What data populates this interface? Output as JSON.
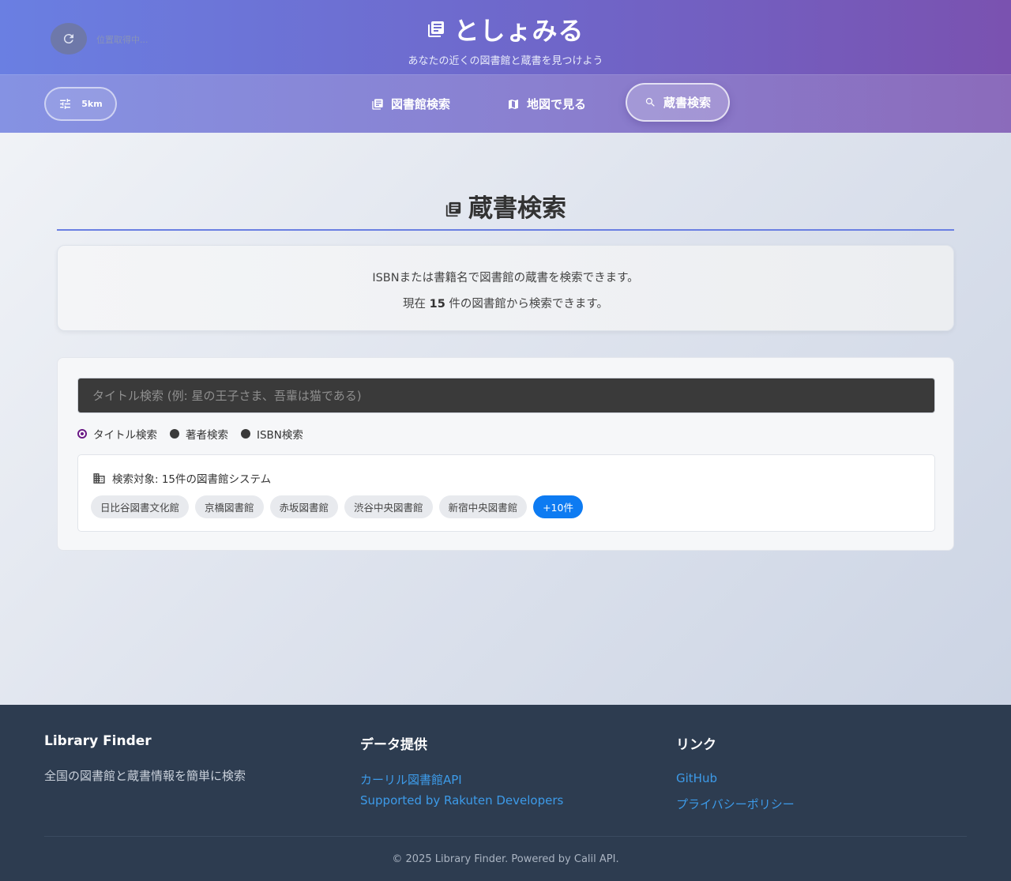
{
  "header": {
    "location_status": "位置取得中...",
    "app_title": "としょみる",
    "subtitle": "あなたの近くの図書館と蔵書を見つけよう"
  },
  "nav": {
    "range_label": "5km",
    "items": [
      {
        "label": "図書館検索",
        "icon": "library-icon"
      },
      {
        "label": "地図で見る",
        "icon": "map-icon"
      },
      {
        "label": "蔵書検索",
        "icon": "search-icon",
        "active": true
      }
    ]
  },
  "main": {
    "page_title": "蔵書検索",
    "info_line1": "ISBNまたは書籍名で図書館の蔵書を検索できます。",
    "info_line2_prefix": "現在",
    "info_count": "15",
    "info_line2_suffix": "件の図書館から検索できます。",
    "search": {
      "placeholder": "タイトル検索 (例: 星の王子さま、吾輩は猫である)",
      "value": "",
      "modes": [
        {
          "label": "タイトル検索",
          "selected": true
        },
        {
          "label": "著者検索",
          "selected": false
        },
        {
          "label": "ISBN検索",
          "selected": false
        }
      ]
    },
    "targets": {
      "heading": "検索対象: 15件の図書館システム",
      "libraries": [
        "日比谷図書文化館",
        "京橋図書館",
        "赤坂図書館",
        "渋谷中央図書館",
        "新宿中央図書館"
      ],
      "more_label": "+10件"
    }
  },
  "footer": {
    "col1": {
      "heading": "Library Finder",
      "text": "全国の図書館と蔵書情報を簡単に検索"
    },
    "col2": {
      "heading": "データ提供",
      "links": [
        "カーリル図書館API",
        "Supported by Rakuten Developers"
      ]
    },
    "col3": {
      "heading": "リンク",
      "links": [
        "GitHub",
        "プライバシーポリシー"
      ]
    },
    "copyright": "© 2025 Library Finder. Powered by Calil API."
  },
  "colors": {
    "header_start": "#6a7fe2",
    "header_end": "#7a52b0",
    "accent_blue": "#0d7bf2",
    "footer_bg": "#2d3c50",
    "footer_link": "#3d9be9",
    "radio_selected": "#6b1a86"
  }
}
